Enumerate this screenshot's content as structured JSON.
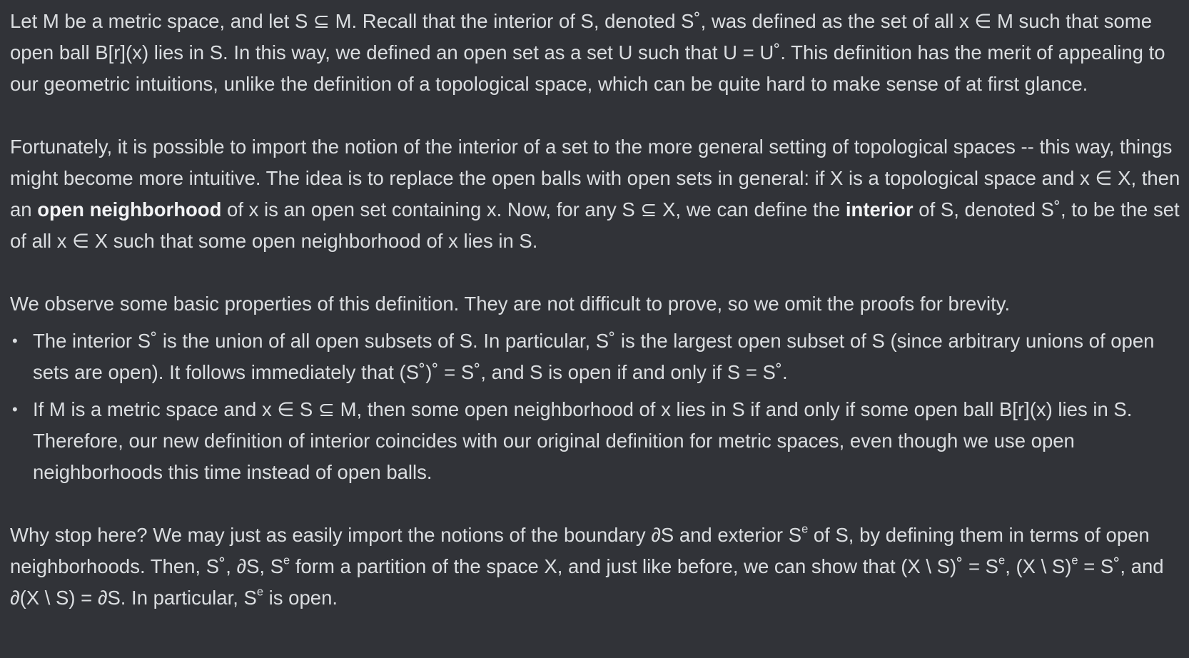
{
  "message": {
    "para1": "Let M be a metric space, and let S ⊆ M. Recall that the interior of S, denoted S˚, was defined as the set of all x ∈ M such that some open ball B[r](x) lies in S. In this way, we defined an open set as a set U such that U = U˚. This definition has the merit of appealing to our geometric intuitions, unlike the definition of a topological space, which can be quite hard to make sense of at first glance.",
    "para2": {
      "part1": "Fortunately, it is possible to import the notion of the interior of a set to the more general setting of topological spaces -- this way, things might become more intuitive. The idea is to replace the open balls with open sets in general: if X is a topological space and x ∈ X, then an ",
      "bold1": "open neighborhood",
      "part2": " of x is an open set containing x. Now, for any S ⊆ X, we can define the ",
      "bold2": "interior",
      "part3": " of S, denoted S˚, to be the set of all x ∈ X such that some open neighborhood of x lies in S."
    },
    "para3": "We observe some basic properties of this definition. They are not difficult to prove, so we omit the proofs for brevity.",
    "bullets": [
      "The interior S˚ is the union of all open subsets of S. In particular, S˚ is the largest open subset of S (since arbitrary unions of open sets are open). It follows immediately that (S˚)˚ = S˚, and S is open if and only if S = S˚.",
      "If M is a metric space and x ∈ S ⊆ M, then some open neighborhood of x lies in S if and only if some open ball B[r](x) lies in S. Therefore, our new definition of interior coincides with our original definition for metric spaces, even though we use open neighborhoods this time instead of open balls."
    ],
    "bullet_glyph": "•",
    "para4": {
      "part1": "Why stop here? We may just as easily import the notions of the boundary ∂S and exterior S",
      "sup1": "e",
      "part2": " of S, by defining them in terms of open neighborhoods. Then, S˚, ∂S, S",
      "sup2": "e",
      "part3": " form a partition of the space X, and just like before, we can show that (X \\ S)˚ = S",
      "sup3": "e",
      "part4": ", (X \\ S)",
      "sup4": "e",
      "part5": " = S˚, and ∂(X \\ S) = ∂S. In particular, S",
      "sup5": "e",
      "part6": " is open."
    }
  }
}
